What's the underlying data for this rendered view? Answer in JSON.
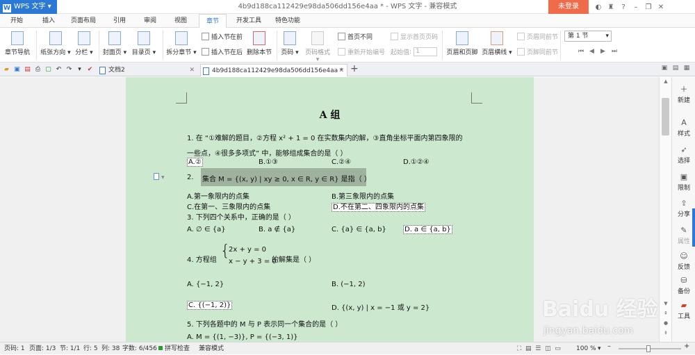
{
  "app": {
    "name": "WPS 文字",
    "window_title": "4b9d188ca112429e98da506dd156e4aa * - WPS 文字 - 兼容模式",
    "login": "未登录"
  },
  "menu": [
    "开始",
    "插入",
    "页面布局",
    "引用",
    "审阅",
    "视图",
    "章节",
    "开发工具",
    "特色功能"
  ],
  "active_menu": "章节",
  "ribbon": {
    "chapter_nav": "章节导航",
    "paper_dir": "纸张方向",
    "columns": "分栏",
    "cover": "封面页",
    "toc": "目录页",
    "split": "拆分章节",
    "insert_before": "插入节在前",
    "insert_after": "插入节在后",
    "delete_section": "删除本节",
    "page_num": "页码",
    "page_format": "页码格式",
    "diff_first": "首页不同",
    "show_first_num": "显示首页页码",
    "restart_num": "重新开始编号",
    "start_value_label": "起始值",
    "start_value": "1",
    "header_footer": "页眉和页脚",
    "header_line": "页眉横线",
    "same_prev_header": "页眉同前节",
    "same_prev_footer": "页脚同前节",
    "section_select": "第 1 节"
  },
  "tabs": [
    {
      "label": "文档2",
      "active": false
    },
    {
      "label": "4b9d188ca112429e98da506dd156e4aa *",
      "active": true
    }
  ],
  "doc": {
    "heading": "A 组",
    "q1_a": "1.    在 “①难解的题目，②方程 x² + 1 = 0 在实数集内的解，③直角坐标平面内第四象限的",
    "q1_b": "一些点，④很多多项式” 中，能够组成集合的是（     ）",
    "q1_opts": [
      "A.②",
      "B.①③",
      "C.②④",
      "D.①②④"
    ],
    "q2_num": "2.",
    "q2_text": "集合 M = {(x, y) | xy ≥ 0, x ∈ R, y ∈ R} 是指（     ）",
    "q2_opts": [
      "A.第一象限内的点集",
      "B.第三象限内的点集",
      "C.在第一、三象限内的点集",
      "D.不在第二、四象限内的点集"
    ],
    "q3": "3.    下列四个关系中，正确的是（     ）",
    "q3_opts": [
      "A. ∅ ∈ {a}",
      "B. a ∉ {a}",
      "C. {a} ∈ {a, b}",
      "D. a ∈ {a, b}"
    ],
    "q4_pre": "4.    方程组",
    "q4_eq1": "2x + y = 0",
    "q4_eq2": "x − y + 3 = 0",
    "q4_post": "的解集是（     ）",
    "q4_opts": [
      "A. {−1, 2}",
      "B. (−1, 2)",
      "C. {(−1, 2)}",
      "D. {(x, y) | x = −1 或 y = 2}"
    ],
    "q5": "5.    下列各题中的 M 与 P 表示同一个集合的是（     ）",
    "q5_a": "A. M = {(1, −3)}, P = {(−3, 1)}"
  },
  "side": [
    "新建",
    "样式",
    "选择",
    "限制",
    "分享",
    "属性",
    "反馈",
    "备份",
    "工具"
  ],
  "status": {
    "page": "页码: 1",
    "pages": "页面: 1/3",
    "section": "节: 1/1",
    "row": "行: 5",
    "col": "列: 38",
    "words": "字数: 6/456",
    "spell": "拼写检查",
    "compat": "兼容模式",
    "zoom": "100 %"
  },
  "watermark": {
    "brand": "Baidu 经验",
    "url": "jingyan.baidu.com"
  }
}
